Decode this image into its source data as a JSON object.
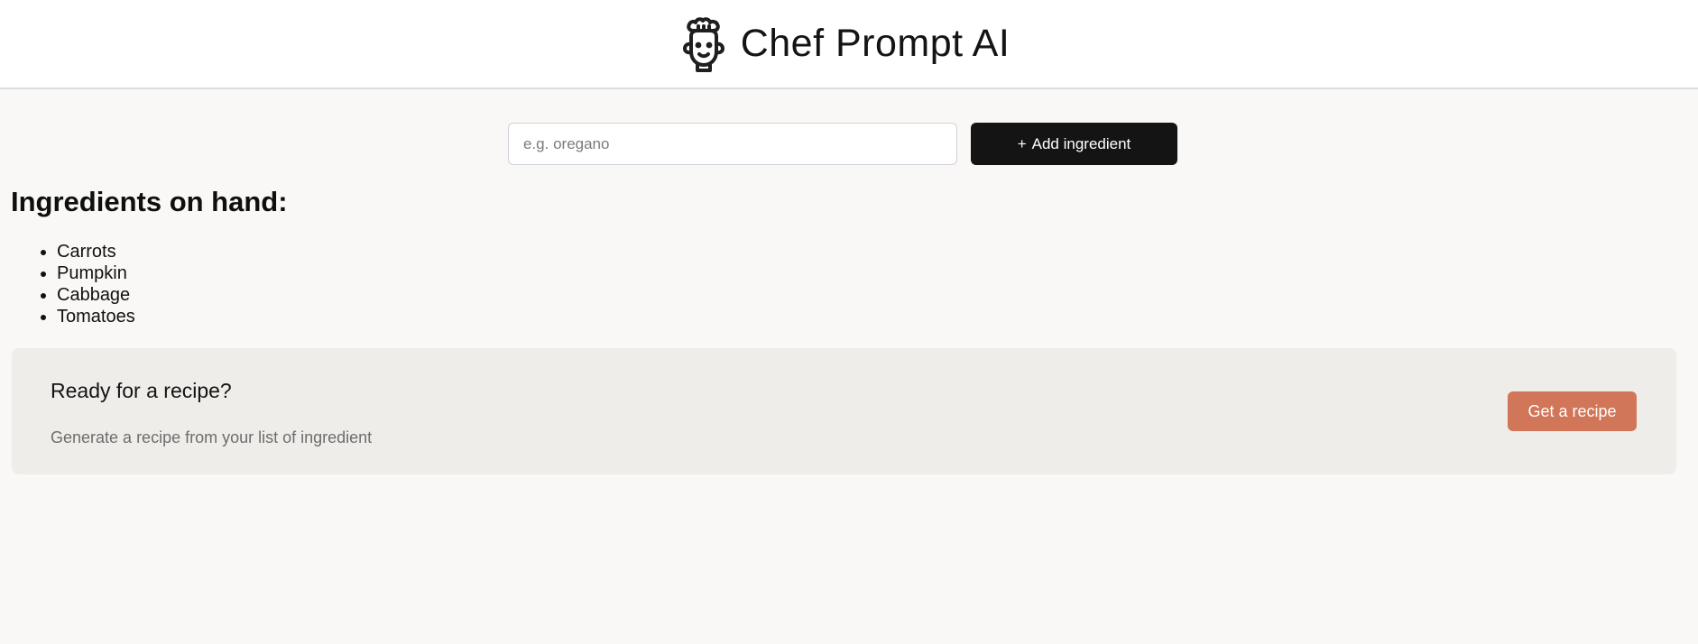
{
  "header": {
    "icon": "chef-bot-icon",
    "title": "Chef Prompt AI"
  },
  "add_form": {
    "input_placeholder": "e.g. oregano",
    "input_value": "",
    "button_icon": "+",
    "button_label": "Add ingredient"
  },
  "ingredients": {
    "heading": "Ingredients on hand:",
    "items": [
      "Carrots",
      "Pumpkin",
      "Cabbage",
      "Tomatoes"
    ]
  },
  "recipe_cta": {
    "title": "Ready for a recipe?",
    "subtitle": "Generate a recipe from your list of ingredient",
    "button_label": "Get a recipe",
    "button_color": "#d17658"
  }
}
